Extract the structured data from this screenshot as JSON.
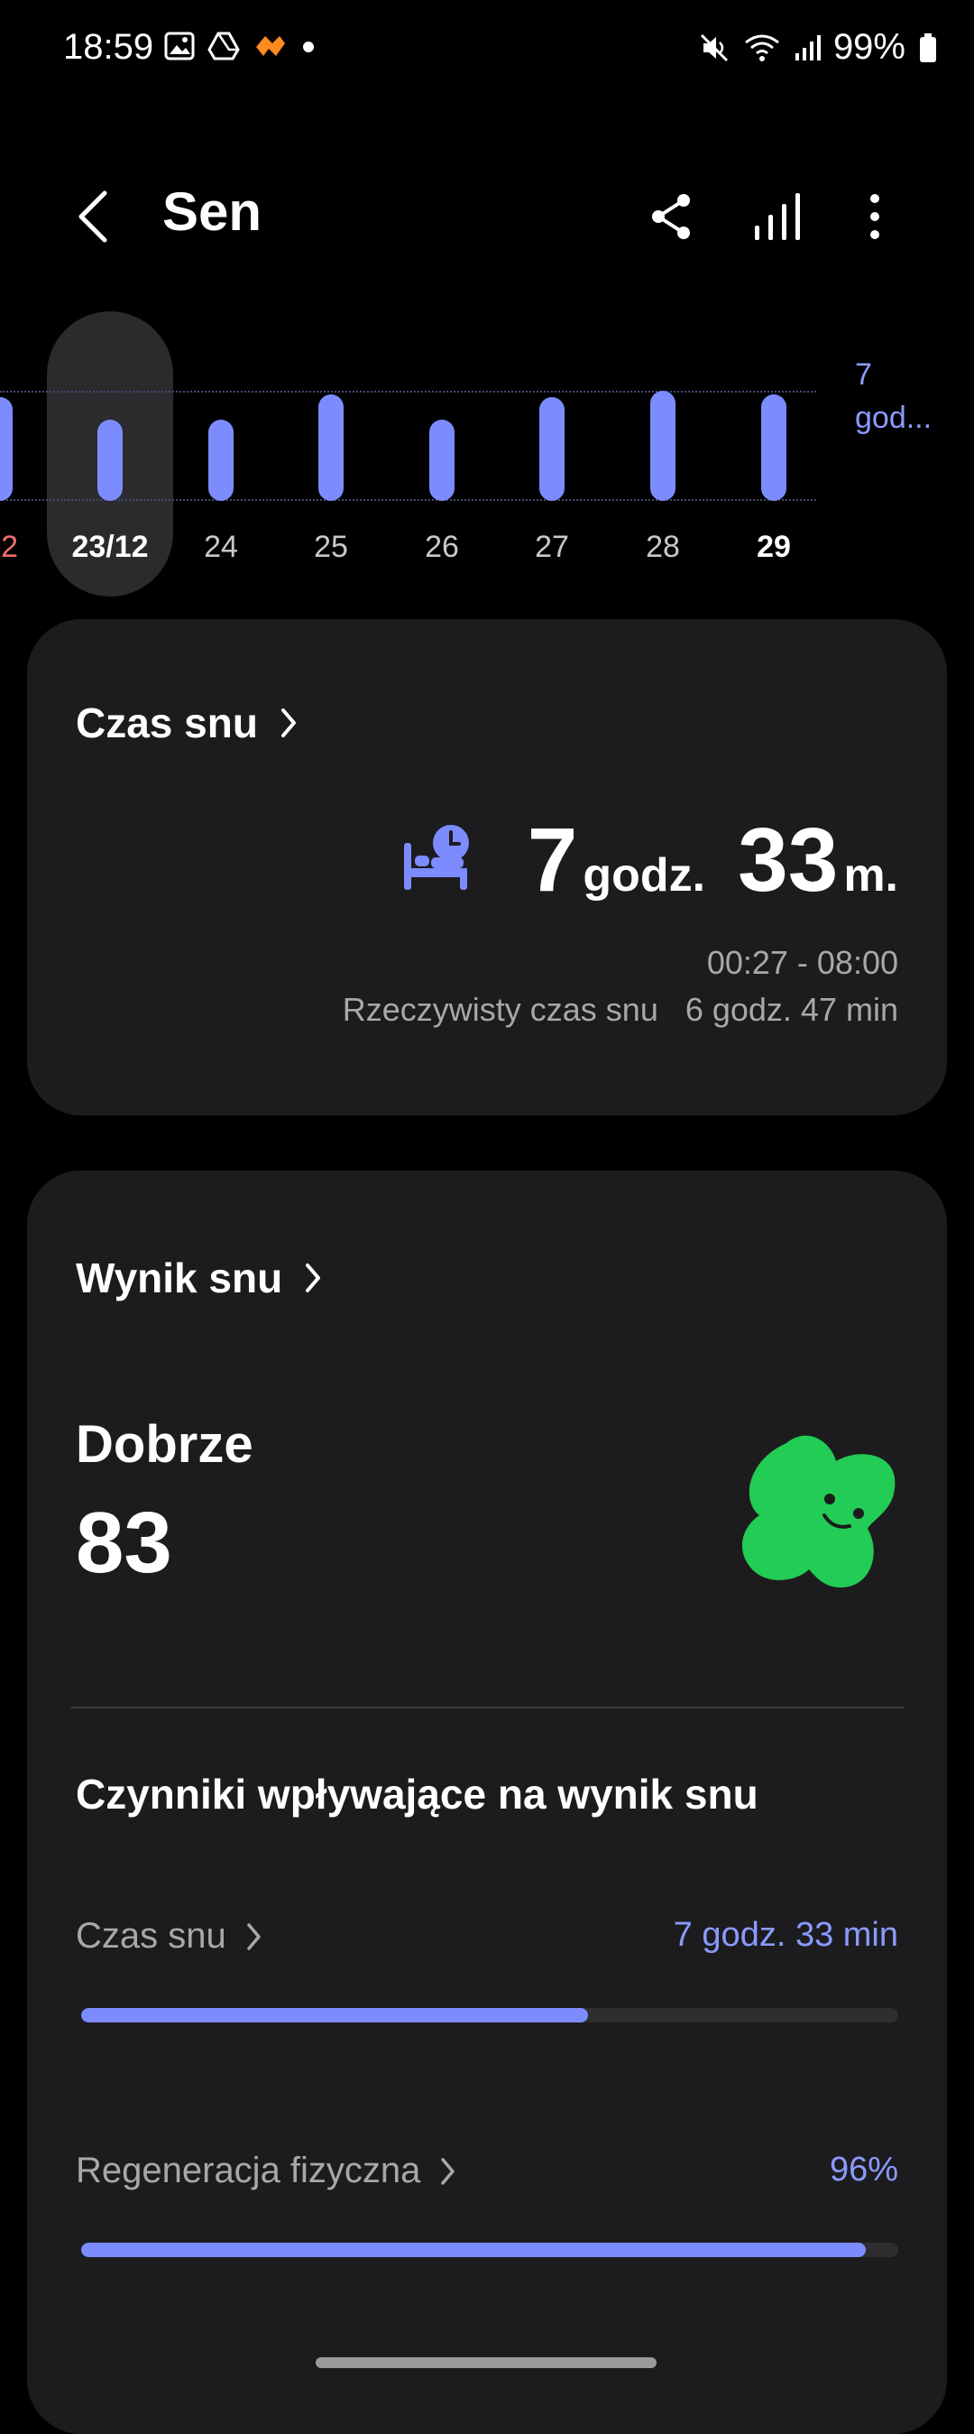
{
  "status_bar": {
    "time": "18:59",
    "battery": "99%"
  },
  "header": {
    "title": "Sen"
  },
  "week": {
    "average_label_line1": "7",
    "average_label_line2": "god...",
    "days": [
      {
        "label": "2",
        "hours": 7.2,
        "state": "red"
      },
      {
        "label": "23/12",
        "hours": 5.6,
        "state": "selected"
      },
      {
        "label": "24",
        "hours": 5.6,
        "state": "normal"
      },
      {
        "label": "25",
        "hours": 7.4,
        "state": "normal"
      },
      {
        "label": "26",
        "hours": 5.6,
        "state": "normal"
      },
      {
        "label": "27",
        "hours": 7.2,
        "state": "normal"
      },
      {
        "label": "28",
        "hours": 7.6,
        "state": "normal"
      },
      {
        "label": "29",
        "hours": 7.4,
        "state": "bold"
      }
    ]
  },
  "sleep_time_card": {
    "title": "Czas snu",
    "hours": "7",
    "hours_unit": "godz.",
    "minutes": "33",
    "minutes_unit": "m.",
    "range": "00:27 - 08:00",
    "actual_label": "Rzeczywisty czas snu",
    "actual_value": "6 godz. 47 min"
  },
  "score_card": {
    "title": "Wynik snu",
    "rating": "Dobrze",
    "score": "83",
    "factors_title": "Czynniki wpływające na wynik snu",
    "factors": [
      {
        "label": "Czas snu",
        "value": "7 godz. 33 min",
        "progress": 0.62
      },
      {
        "label": "Regeneracja fizyczna",
        "value": "96%",
        "progress": 0.96
      }
    ]
  },
  "colors": {
    "accent": "#7c8cff",
    "card": "#1c1c1e",
    "mascot": "#22cc55"
  }
}
